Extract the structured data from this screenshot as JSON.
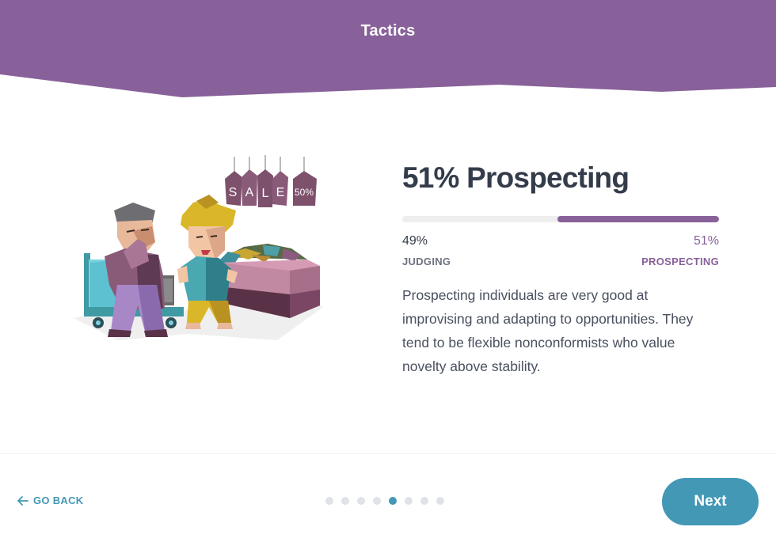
{
  "header": {
    "title": "Tactics",
    "color": "#88619a"
  },
  "illustration": {
    "sale_tag_letters": [
      "S",
      "A",
      "L",
      "E"
    ],
    "discount_tag": "50%"
  },
  "trait": {
    "title": "51% Prospecting",
    "left_percent_text": "49%",
    "right_percent_text": "51%",
    "left_label": "JUDGING",
    "right_label": "PROSPECTING",
    "right_fraction": 0.51,
    "description": "Prospecting individuals are very good at improvising and adapting to opportunities. They tend to be flexible nonconformists who value novelty above stability."
  },
  "footer": {
    "go_back_label": "GO BACK",
    "next_label": "Next",
    "steps_total": 8,
    "current_step": 5,
    "accent": "#4298b5"
  }
}
